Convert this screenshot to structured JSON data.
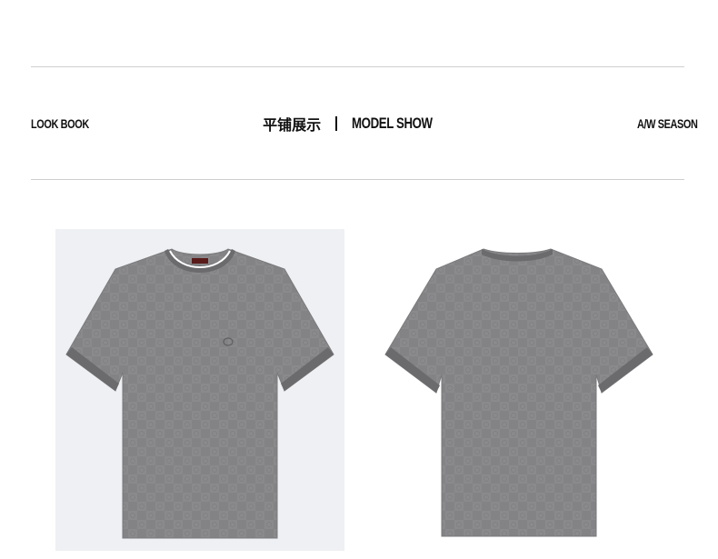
{
  "header": {
    "left_label": "LOOK BOOK",
    "title_cn": "平铺展示",
    "title_en": "MODEL SHOW",
    "right_label": "A/W SEASON"
  },
  "products": [
    {
      "view": "front",
      "shirt_color": "#8a8a8c",
      "collar_color": "#6b6b6e",
      "trim_color": "#ffffff",
      "cuff_color": "#6b6b6e"
    },
    {
      "view": "back",
      "shirt_color": "#8a8a8c",
      "collar_color": "#6b6b6e",
      "cuff_color": "#6b6b6e"
    }
  ]
}
